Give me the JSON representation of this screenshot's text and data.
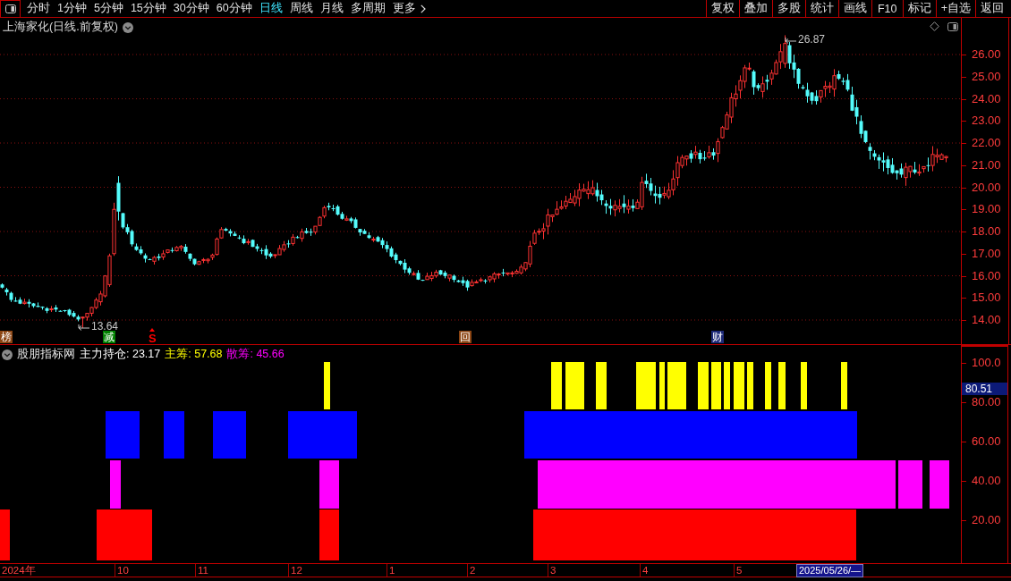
{
  "toolbar": {
    "period_tabs": [
      {
        "label": "分时",
        "kind": "tab",
        "selected": false
      },
      {
        "label": "1分钟",
        "kind": "tab",
        "selected": false
      },
      {
        "label": "5分钟",
        "kind": "tab",
        "selected": false
      },
      {
        "label": "15分钟",
        "kind": "tab",
        "selected": false
      },
      {
        "label": "30分钟",
        "kind": "tab",
        "selected": false
      },
      {
        "label": "60分钟",
        "kind": "tab",
        "selected": false
      },
      {
        "label": "日线",
        "kind": "tab",
        "selected": true
      },
      {
        "label": "周线",
        "kind": "tab",
        "selected": false
      },
      {
        "label": "月线",
        "kind": "tab",
        "selected": false
      },
      {
        "label": "多周期",
        "kind": "tab",
        "selected": false
      },
      {
        "label": "更多",
        "kind": "menu",
        "selected": false
      }
    ],
    "actions": [
      "复权",
      "叠加",
      "多股",
      "统计",
      "画线",
      "F10",
      "标记",
      "+自选",
      "返回"
    ]
  },
  "price_chart": {
    "title": "上海家化(日线.前复权)",
    "high_label": "26.87",
    "low_label": "13.64",
    "event_marks": [
      {
        "text": "榜",
        "kind": "tile",
        "color": "#8b4513"
      },
      {
        "text": "减",
        "kind": "tile",
        "color": "#008000"
      },
      {
        "text": "S",
        "kind": "signal",
        "color": "#ff0000"
      },
      {
        "text": "回",
        "kind": "tile",
        "color": "#8b4513"
      },
      {
        "text": "财",
        "kind": "tile",
        "color": "#1e2a78"
      }
    ],
    "y_axis": [
      "26.00",
      "25.00",
      "24.00",
      "23.00",
      "22.00",
      "21.00",
      "20.00",
      "19.00",
      "18.00",
      "17.00",
      "16.00",
      "15.00",
      "14.00"
    ]
  },
  "indicator": {
    "name": "股朋指标网",
    "legend": [
      {
        "text": "主力持仓: 23.17",
        "color": "#ffffff"
      },
      {
        "text": "主筹: 57.68",
        "color": "#ffff00"
      },
      {
        "text": "散筹: 45.66",
        "color": "#ff00ff"
      }
    ],
    "y_axis": [
      "100.0",
      "80.00",
      "60.00",
      "40.00",
      "20.00"
    ],
    "cursor_value": "80.51"
  },
  "time_axis": {
    "labels": [
      "2024年",
      "10",
      "11",
      "12",
      "1",
      "2",
      "3",
      "4",
      "5"
    ],
    "cursor_date": "2025/05/26/—"
  }
}
